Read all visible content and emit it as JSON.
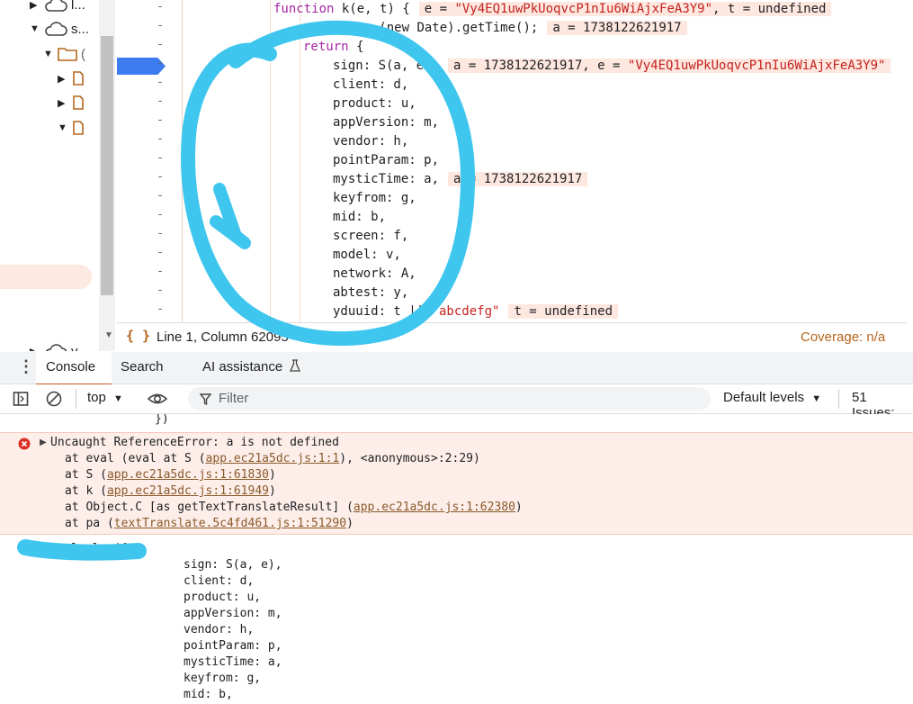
{
  "tree": {
    "items": [
      {
        "label": "l...",
        "icon": "cloud-icon",
        "toggle": "▶"
      },
      {
        "label": "s...",
        "icon": "cloud-icon",
        "toggle": "▼"
      },
      {
        "label": "(",
        "icon": "folder-icon",
        "toggle": "▼"
      },
      {
        "label": "",
        "icon": "file-icon",
        "toggle": "▶"
      },
      {
        "label": "",
        "icon": "file-icon",
        "toggle": "▶"
      },
      {
        "label": "",
        "icon": "file-icon",
        "toggle": "▼"
      },
      {
        "label": "v",
        "icon": "cloud-icon",
        "toggle": "▶"
      }
    ]
  },
  "editor": {
    "gutter_marker": "-",
    "lines": [
      {
        "code_pre": "",
        "kw": "function",
        "code": " k(e, t) {",
        "val_label": "e = ",
        "val_str": "\"Vy4EQ1uwPkUoqvcP1nIu6WiAjxFeA3Y9\"",
        "val_rest": ", t = undefined"
      },
      {
        "kw": "const",
        "code": " a = (new Date).getTime();",
        "val": "a = 1738122621917"
      },
      {
        "kw": "return",
        "code": " {"
      },
      {
        "code": "sign: S(a, e),",
        "val_label": "a = 1738122621917, e = ",
        "val_str": "\"Vy4EQ1uwPkUoqvcP1nIu6WiAjxFeA3Y9\""
      },
      {
        "code": "client: d,"
      },
      {
        "code": "product: u,"
      },
      {
        "code": "appVersion: m,"
      },
      {
        "code": "vendor: h,"
      },
      {
        "code": "pointParam: p,"
      },
      {
        "code": "mysticTime: a,",
        "val": "a = 1738122621917"
      },
      {
        "code": "keyfrom: g,"
      },
      {
        "code": "mid: b,"
      },
      {
        "code": "screen: f,"
      },
      {
        "code": "model: v,"
      },
      {
        "code": "network: A,"
      },
      {
        "code": "abtest: y,"
      },
      {
        "code": "yduuid: t || ",
        "str": "\"abcdefg\"",
        "val": "t = undefined"
      }
    ]
  },
  "status": {
    "braces": "{ }",
    "position": "Line 1, Column 62095",
    "coverage": "Coverage: n/a"
  },
  "tabs": {
    "items": [
      "Console",
      "Search",
      "AI assistance"
    ]
  },
  "toolbar": {
    "context": "top",
    "filter_placeholder": "Filter",
    "levels": "Default levels",
    "issues": "51 Issues:"
  },
  "console": {
    "prev_tail": "})",
    "error_title": "Uncaught ReferenceError: a is not defined",
    "stack": [
      {
        "pre": "at eval (eval at S (",
        "link": "app.ec21a5dc.js:1:1",
        "post": "), <anonymous>:2:29)"
      },
      {
        "pre": "at S (",
        "link": "app.ec21a5dc.js:1:61830",
        "post": ")"
      },
      {
        "pre": "at k (",
        "link": "app.ec21a5dc.js:1:61949",
        "post": ")"
      },
      {
        "pre": "at Object.C [as getTextTranslateResult] (",
        "link": "app.ec21a5dc.js:1:62380",
        "post": ")"
      },
      {
        "pre": "at pa (",
        "link": "textTranslate.5c4fd461.js:1:51290",
        "post": ")"
      }
    ],
    "input_first": "console.log({",
    "input_lines": [
      "sign: S(a, e),",
      "client: d,",
      "product: u,",
      "appVersion: m,",
      "vendor: h,",
      "pointParam: p,",
      "mysticTime: a,",
      "keyfrom: g,",
      "mid: b,"
    ]
  },
  "colors": {
    "annotation": "#3ec6ee",
    "error_bg": "#fdeeea",
    "breakpoint": "#3c7bf0"
  }
}
